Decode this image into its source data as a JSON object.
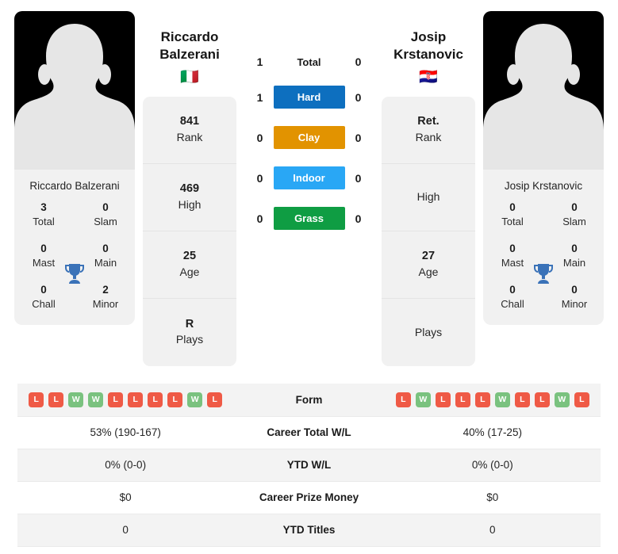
{
  "players": {
    "left": {
      "first_name": "Riccardo",
      "last_name": "Balzerani",
      "full_name_caption": "Riccardo Balzerani",
      "flag": "🇮🇹",
      "flag_name": "italy-flag",
      "rank": "841",
      "rank_label": "Rank",
      "high": "469",
      "high_label": "High",
      "age": "25",
      "age_label": "Age",
      "plays": "R",
      "plays_label": "Plays",
      "titles": {
        "total": "3",
        "total_label": "Total",
        "slam": "0",
        "slam_label": "Slam",
        "mast": "0",
        "mast_label": "Mast",
        "main": "0",
        "main_label": "Main",
        "chall": "0",
        "chall_label": "Chall",
        "minor": "2",
        "minor_label": "Minor"
      },
      "form": [
        "L",
        "L",
        "W",
        "W",
        "L",
        "L",
        "L",
        "L",
        "W",
        "L"
      ]
    },
    "right": {
      "first_name": "Josip",
      "last_name": "Krstanovic",
      "full_name_caption": "Josip Krstanovic",
      "flag": "🇭🇷",
      "flag_name": "croatia-flag",
      "rank": "Ret.",
      "rank_label": "Rank",
      "high": "",
      "high_label": "High",
      "age": "27",
      "age_label": "Age",
      "plays": "",
      "plays_label": "Plays",
      "titles": {
        "total": "0",
        "total_label": "Total",
        "slam": "0",
        "slam_label": "Slam",
        "mast": "0",
        "mast_label": "Mast",
        "main": "0",
        "main_label": "Main",
        "chall": "0",
        "chall_label": "Chall",
        "minor": "0",
        "minor_label": "Minor"
      },
      "form": [
        "L",
        "W",
        "L",
        "L",
        "L",
        "W",
        "L",
        "L",
        "W",
        "L"
      ]
    }
  },
  "head_to_head": [
    {
      "label": "Total",
      "left": "1",
      "right": "0",
      "style": "plain",
      "color": ""
    },
    {
      "label": "Hard",
      "left": "1",
      "right": "0",
      "style": "badge",
      "color": "#0d6fbf"
    },
    {
      "label": "Clay",
      "left": "0",
      "right": "0",
      "style": "badge",
      "color": "#e29300"
    },
    {
      "label": "Indoor",
      "left": "0",
      "right": "0",
      "style": "badge",
      "color": "#29a7f5"
    },
    {
      "label": "Grass",
      "left": "0",
      "right": "0",
      "style": "badge",
      "color": "#0f9d43"
    }
  ],
  "comparison_rows": [
    {
      "label": "Form",
      "left": "",
      "right": "",
      "type": "form"
    },
    {
      "label": "Career Total W/L",
      "left": "53% (190-167)",
      "right": "40% (17-25)",
      "type": "text"
    },
    {
      "label": "YTD W/L",
      "left": "0% (0-0)",
      "right": "0% (0-0)",
      "type": "text"
    },
    {
      "label": "Career Prize Money",
      "left": "$0",
      "right": "$0",
      "type": "text"
    },
    {
      "label": "YTD Titles",
      "left": "0",
      "right": "0",
      "type": "text"
    }
  ],
  "colors": {
    "win": "#7ac27f",
    "loss": "#ef5a46",
    "card_bg": "#f1f1f1",
    "stripe": "#f3f3f3"
  }
}
